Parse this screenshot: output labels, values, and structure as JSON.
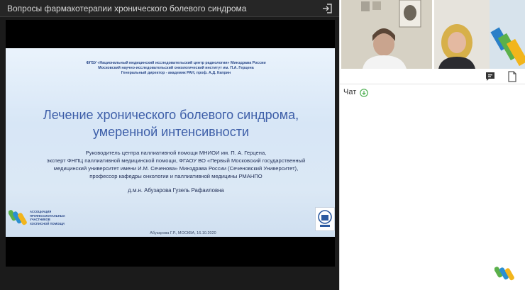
{
  "window": {
    "title": "Вопросы фармакотерапии хронического болевого синдрома"
  },
  "slide": {
    "header_lines": [
      "ФГБУ «Национальный медицинский исследовательский центр радиологии» Минздрава России",
      "Московский научно-исследовательский онкологический институт им. П.А. Герцена",
      "Генеральный директор - академик РАН, проф. А.Д. Каприн"
    ],
    "title_lines": [
      "Лечение хронического болевого синдрома,",
      "умеренной интенсивности"
    ],
    "body_lines": [
      "Руководитель центра паллиативной помощи МНИОИ им. П. А. Герцена,",
      "эксперт ФНПЦ паллиативной медицинской помощи, ФГАОУ ВО «Первый Московский государственный",
      "медицинский университет имени И.М. Сеченова» Минздрава России (Сеченовский Университет),",
      "профессор кафедры онкологии и паллиативной медицины РМАНПО"
    ],
    "author": "д.м.н. Абузарова Гузель Рафаиловна",
    "association_lines": [
      "АССОЦИАЦИЯ",
      "ПРОФЕССИОНАЛЬНЫХ",
      "УЧАСТНИКОВ",
      "ХОСПИСНОЙ ПОМОЩИ"
    ],
    "footer": "Абузарова Г.Р., МОСКВА, 16.10.2020"
  },
  "chat": {
    "label": "Чат"
  },
  "icons": {
    "exit": "exit-icon",
    "chat": "chat-icon",
    "file": "file-icon",
    "download": "download-icon"
  },
  "colors": {
    "accent_green": "#4caf50",
    "slide_title": "#3d5ea8"
  }
}
